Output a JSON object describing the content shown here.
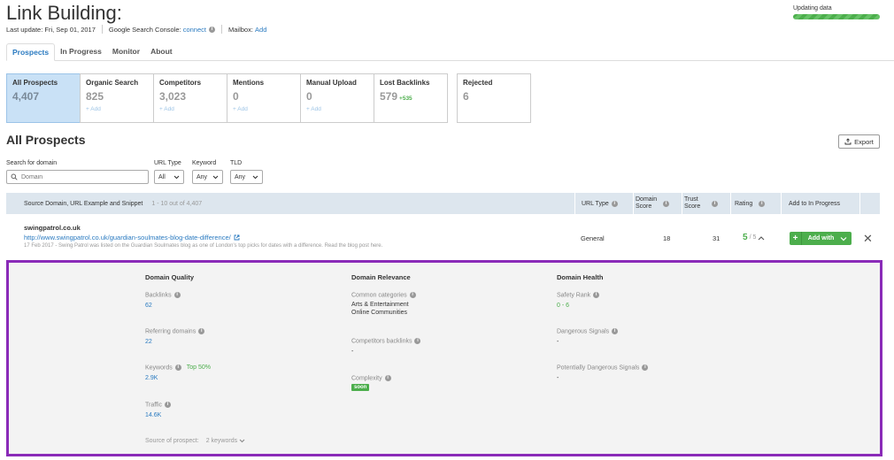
{
  "page": {
    "title": "Link Building:",
    "last_update": "Last update: Fri, Sep 01, 2017",
    "gsc_label": "Google Search Console:",
    "gsc_link": "connect",
    "mailbox_label": "Mailbox:",
    "mailbox_link": "Add",
    "updating": "Updating data"
  },
  "tabs": [
    "Prospects",
    "In Progress",
    "Monitor",
    "About"
  ],
  "cards": [
    {
      "label": "All Prospects",
      "value": "4,407",
      "add": ""
    },
    {
      "label": "Organic Search",
      "value": "825",
      "add": "+ Add"
    },
    {
      "label": "Competitors",
      "value": "3,023",
      "add": "+ Add"
    },
    {
      "label": "Mentions",
      "value": "0",
      "add": "+ Add"
    },
    {
      "label": "Manual Upload",
      "value": "0",
      "add": "+ Add"
    },
    {
      "label": "Lost Backlinks",
      "value": "579",
      "extra": "+535",
      "add": ""
    },
    {
      "label": "Rejected",
      "value": "6",
      "add": ""
    }
  ],
  "section_title": "All Prospects",
  "export_label": "Export",
  "filters": {
    "search_label": "Search for domain",
    "search_placeholder": "Domain",
    "url_type_label": "URL Type",
    "url_type_value": "All",
    "keyword_label": "Keyword",
    "keyword_value": "Any",
    "tld_label": "TLD",
    "tld_value": "Any"
  },
  "table": {
    "col_source": "Source Domain, URL Example and Snippet",
    "range": "1 - 10 out of 4,407",
    "col_url_type": "URL Type",
    "col_domain_score": "Domain Score",
    "col_trust_score": "Trust Score",
    "col_rating": "Rating",
    "col_add": "Add to In Progress"
  },
  "row": {
    "domain": "swingpatrol.co.uk",
    "url": "http://www.swingpatrol.co.uk/guardian-soulmates-blog-date-difference/",
    "snippet": "17 Feb 2017 - Swing Patrol was listed on the Guardian Soulmates blog as one of London's top picks for dates with a difference. Read the blog post here.",
    "url_type": "General",
    "domain_score": "18",
    "trust_score": "31",
    "rating": "5",
    "rating_of": "/ 5",
    "add_with": "Add with"
  },
  "details": {
    "quality": {
      "heading": "Domain Quality",
      "backlinks_label": "Backlinks",
      "backlinks": "62",
      "referring_label": "Referring domains",
      "referring": "22",
      "keywords_label": "Keywords",
      "keywords_top": "Top 50%",
      "keywords": "2.9K",
      "traffic_label": "Traffic",
      "traffic": "14.6K",
      "source_label": "Source of prospect:",
      "source_value": "2 keywords"
    },
    "relevance": {
      "heading": "Domain Relevance",
      "categories_label": "Common categories",
      "cat1": "Arts & Entertainment",
      "cat2": "Online Communities",
      "competitors_label": "Competitors backlinks",
      "competitors": "-",
      "complexity_label": "Complexity",
      "complexity": "soon"
    },
    "health": {
      "heading": "Domain Health",
      "safety_label": "Safety Rank",
      "safety": "0 - 6",
      "dangerous_label": "Dangerous Signals",
      "dangerous": "-",
      "potential_label": "Potentially Dangerous Signals",
      "potential": "-"
    }
  },
  "colors": {
    "accent": "#2a7ac0",
    "green": "#4cae4c",
    "highlight": "#8a2bb8"
  }
}
